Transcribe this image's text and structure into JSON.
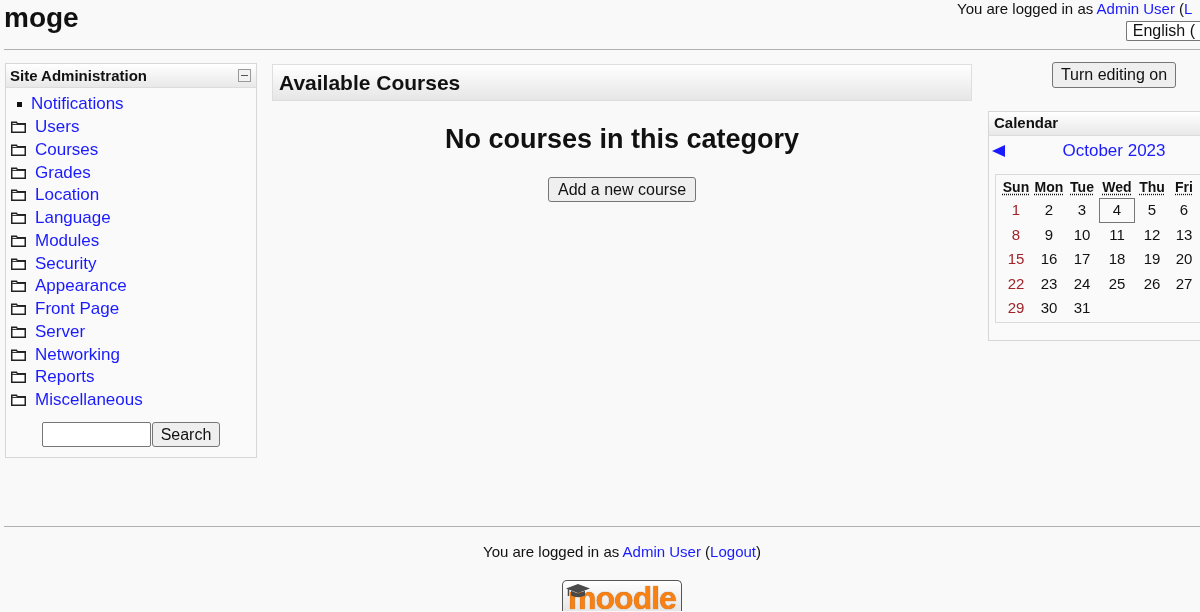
{
  "header": {
    "site_title": "moge",
    "login": [
      {
        "kind": "text",
        "text": "You are logged in as "
      },
      {
        "kind": "link",
        "text": "Admin User"
      },
      {
        "kind": "text",
        "text": " ("
      },
      {
        "kind": "link",
        "text": "L"
      }
    ],
    "language": "English ("
  },
  "admin_block": {
    "title": "Site Administration",
    "items": [
      {
        "kind": "page",
        "label": "Notifications"
      },
      {
        "kind": "folder",
        "label": "Users"
      },
      {
        "kind": "folder",
        "label": "Courses"
      },
      {
        "kind": "folder",
        "label": "Grades"
      },
      {
        "kind": "folder",
        "label": "Location"
      },
      {
        "kind": "folder",
        "label": "Language"
      },
      {
        "kind": "folder",
        "label": "Modules"
      },
      {
        "kind": "folder",
        "label": "Security"
      },
      {
        "kind": "folder",
        "label": "Appearance"
      },
      {
        "kind": "folder",
        "label": "Front Page"
      },
      {
        "kind": "folder",
        "label": "Server"
      },
      {
        "kind": "folder",
        "label": "Networking"
      },
      {
        "kind": "folder",
        "label": "Reports"
      },
      {
        "kind": "folder",
        "label": "Miscellaneous"
      }
    ],
    "search_button": "Search"
  },
  "courses": {
    "heading": "Available Courses",
    "message": "No courses in this category",
    "add_button": "Add a new course"
  },
  "editing_button": "Turn editing on",
  "calendar": {
    "title": "Calendar",
    "month": "October 2023",
    "weekdays": [
      "Sun",
      "Mon",
      "Tue",
      "Wed",
      "Thu",
      "Fri"
    ],
    "weeks": [
      [
        {
          "day": "1",
          "weekend": true,
          "today": false
        },
        {
          "day": "2",
          "weekend": false,
          "today": false
        },
        {
          "day": "3",
          "weekend": false,
          "today": false
        },
        {
          "day": "4",
          "weekend": false,
          "today": true
        },
        {
          "day": "5",
          "weekend": false,
          "today": false
        },
        {
          "day": "6",
          "weekend": false,
          "today": false
        }
      ],
      [
        {
          "day": "8",
          "weekend": true,
          "today": false
        },
        {
          "day": "9",
          "weekend": false,
          "today": false
        },
        {
          "day": "10",
          "weekend": false,
          "today": false
        },
        {
          "day": "11",
          "weekend": false,
          "today": false
        },
        {
          "day": "12",
          "weekend": false,
          "today": false
        },
        {
          "day": "13",
          "weekend": false,
          "today": false
        }
      ],
      [
        {
          "day": "15",
          "weekend": true,
          "today": false
        },
        {
          "day": "16",
          "weekend": false,
          "today": false
        },
        {
          "day": "17",
          "weekend": false,
          "today": false
        },
        {
          "day": "18",
          "weekend": false,
          "today": false
        },
        {
          "day": "19",
          "weekend": false,
          "today": false
        },
        {
          "day": "20",
          "weekend": false,
          "today": false
        }
      ],
      [
        {
          "day": "22",
          "weekend": true,
          "today": false
        },
        {
          "day": "23",
          "weekend": false,
          "today": false
        },
        {
          "day": "24",
          "weekend": false,
          "today": false
        },
        {
          "day": "25",
          "weekend": false,
          "today": false
        },
        {
          "day": "26",
          "weekend": false,
          "today": false
        },
        {
          "day": "27",
          "weekend": false,
          "today": false
        }
      ],
      [
        {
          "day": "29",
          "weekend": true,
          "today": false
        },
        {
          "day": "30",
          "weekend": false,
          "today": false
        },
        {
          "day": "31",
          "weekend": false,
          "today": false
        }
      ]
    ]
  },
  "footer": {
    "login": [
      {
        "kind": "text",
        "text": "You are logged in as "
      },
      {
        "kind": "link",
        "text": "Admin User"
      },
      {
        "kind": "text",
        "text": " ("
      },
      {
        "kind": "link",
        "text": "Logout"
      },
      {
        "kind": "text",
        "text": ")"
      }
    ],
    "logo": "moodle"
  }
}
